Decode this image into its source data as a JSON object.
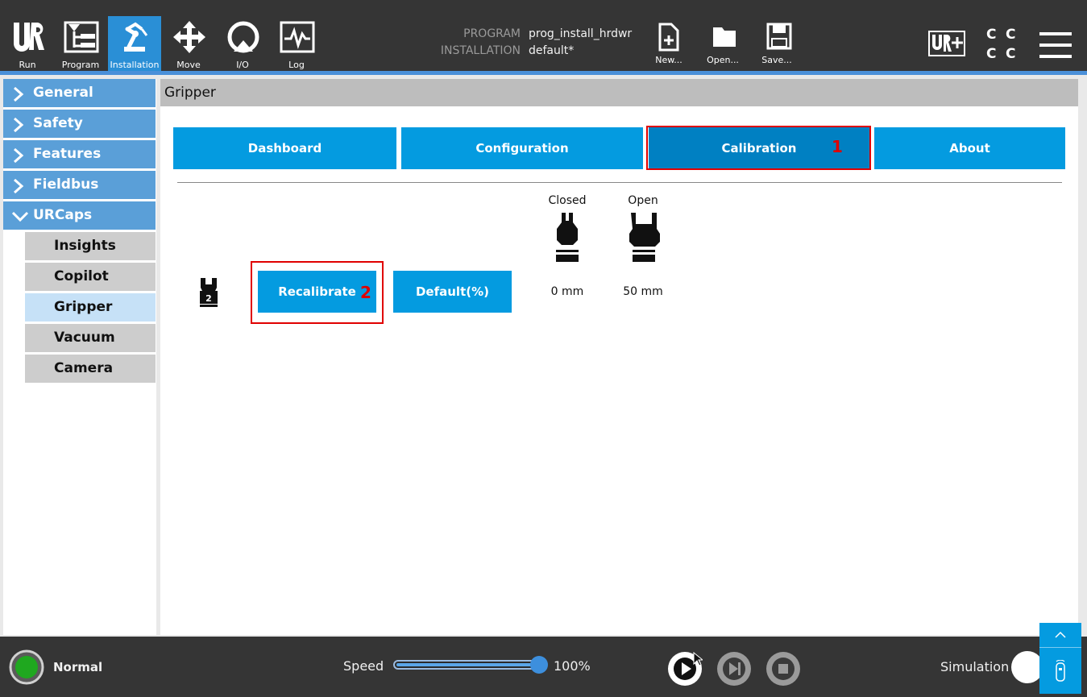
{
  "nav": {
    "tabs": [
      {
        "label": "Run",
        "icon": "ur-logo-icon"
      },
      {
        "label": "Program",
        "icon": "program-tree-icon"
      },
      {
        "label": "Installation",
        "icon": "robot-arm-icon",
        "active": true
      },
      {
        "label": "Move",
        "icon": "move-arrows-icon"
      },
      {
        "label": "I/O",
        "icon": "io-icon"
      },
      {
        "label": "Log",
        "icon": "log-graph-icon"
      }
    ]
  },
  "header": {
    "program_key": "PROGRAM",
    "program_value": "prog_install_hrdwr",
    "installation_key": "INSTALLATION",
    "installation_value": "default*",
    "new_label": "New...",
    "open_label": "Open...",
    "save_label": "Save...",
    "ctrl_letters": [
      "C",
      "C",
      "C",
      "C"
    ]
  },
  "sidebar": {
    "items": [
      {
        "label": "General",
        "expanded": false
      },
      {
        "label": "Safety",
        "expanded": false
      },
      {
        "label": "Features",
        "expanded": false
      },
      {
        "label": "Fieldbus",
        "expanded": false
      },
      {
        "label": "URCaps",
        "expanded": true
      }
    ],
    "subitems": [
      {
        "label": "Insights"
      },
      {
        "label": "Copilot"
      },
      {
        "label": "Gripper",
        "active": true
      },
      {
        "label": "Vacuum"
      },
      {
        "label": "Camera"
      }
    ]
  },
  "main": {
    "title": "Gripper",
    "tabs": [
      {
        "label": "Dashboard"
      },
      {
        "label": "Configuration"
      },
      {
        "label": "Calibration",
        "selected": true
      },
      {
        "label": "About"
      }
    ],
    "markers": [
      "1",
      "2"
    ],
    "recalibrate_label": "Recalibrate",
    "default_label": "Default(%)",
    "closed_label": "Closed",
    "open_label": "Open",
    "closed_value": "0 mm",
    "open_value": "50 mm",
    "gripper_badge": "2"
  },
  "bottom": {
    "status": "Normal",
    "speed_label": "Speed",
    "speed_value": "100%",
    "speed_fraction": 1.0,
    "simulation_label": "Simulation"
  },
  "colors": {
    "accent": "#049be0",
    "accent_selected": "#0080c2",
    "highlight": "#e00000",
    "status_ok": "#1fa81f"
  }
}
